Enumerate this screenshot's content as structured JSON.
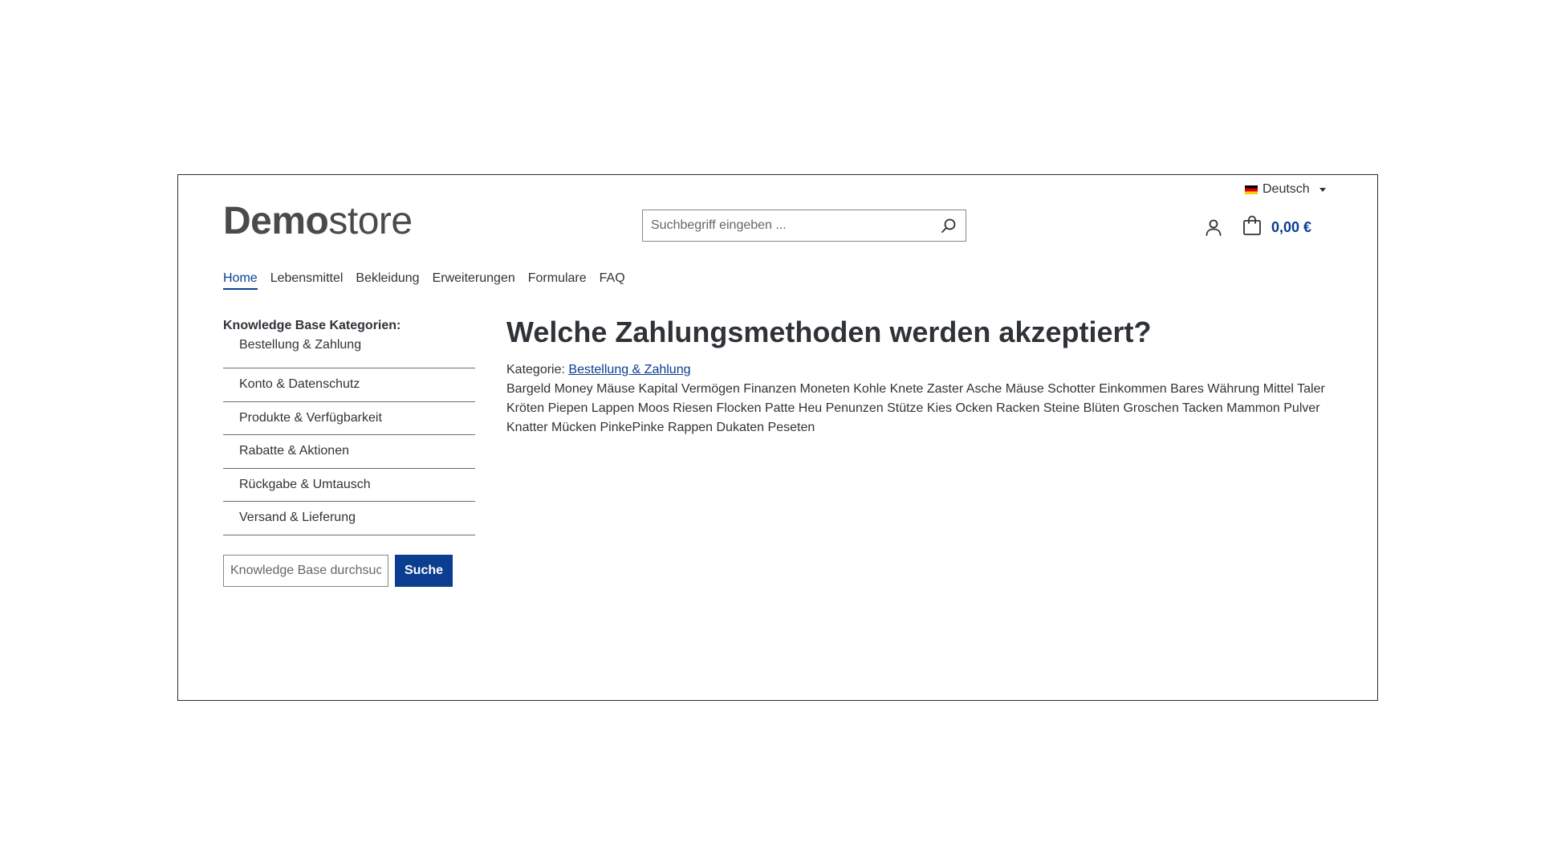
{
  "header": {
    "language": "Deutsch",
    "logo": {
      "bold": "Demo",
      "light": "store"
    },
    "search_placeholder": "Suchbegriff eingeben ...",
    "cart_total": "0,00 €"
  },
  "nav": {
    "items": [
      "Home",
      "Lebensmittel",
      "Bekleidung",
      "Erweiterungen",
      "Formulare",
      "FAQ"
    ],
    "active": "Home"
  },
  "sidebar": {
    "title": "Knowledge Base Kategorien:",
    "categories": [
      "Bestellung & Zahlung",
      "Konto & Datenschutz",
      "Produkte & Verfügbarkeit",
      "Rabatte & Aktionen",
      "Rückgabe & Umtausch",
      "Versand & Lieferung"
    ],
    "search_placeholder": "Knowledge Base durchsuchen",
    "search_button": "Suche"
  },
  "article": {
    "title": "Welche Zahlungsmethoden werden akzeptiert?",
    "category_label": "Kategorie:",
    "category_link": "Bestellung & Zahlung",
    "body": "Bargeld Money Mäuse Kapital Vermögen Finanzen Moneten Kohle Knete Zaster Asche Mäuse Schotter Einkommen Bares Währung Mittel Taler Kröten Piepen Lappen Moos Riesen Flocken Patte Heu Penunzen Stütze Kies Ocken Racken Steine Blüten Groschen Tacken Mammon Pulver Knatter Mücken PinkePinke Rappen Dukaten Peseten"
  },
  "colors": {
    "accent": "#0b3e91",
    "text": "#2f3338"
  }
}
